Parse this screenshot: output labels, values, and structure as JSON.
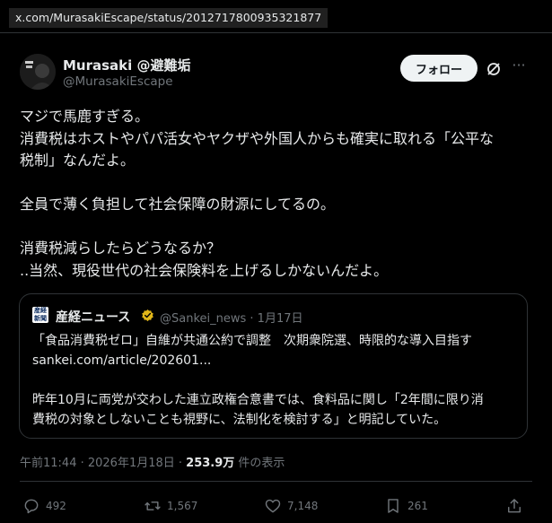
{
  "url_bar": "x.com/MurasakiEscape/status/2012717800935321877",
  "author": {
    "name": "Murasaki @避難垢",
    "handle": "@MurasakiEscape"
  },
  "header": {
    "follow_label": "フォロー",
    "grok_icon": "grok-icon",
    "more_icon": "more-icon"
  },
  "tweet": {
    "lines": [
      "マジで馬鹿すぎる。",
      "消費税はホストやパパ活女やヤクザや外国人からも確実に取れる「公平な",
      "税制」なんだよ。",
      "",
      "全員で薄く負担して社会保障の財源にしてるの。",
      "",
      "消費税減らしたらどうなるか？",
      "..当然、現役世代の社会保険料を上げるしかないんだよ。"
    ]
  },
  "quote": {
    "logo_text": "産経新聞",
    "name": "産経ニュース",
    "handle_date": "@Sankei_news · 1月17日",
    "lines": [
      "「食品消費税ゼロ」自維が共通公約で調整　次期衆院選、時限的な導入目指す",
      "sankei.com/article/202601...",
      "",
      "昨年10月に両党が交わした連立政権合意書では、食料品に関し「2年間に限り消",
      "費税の対象としないことも視野に、法制化を検討する」と明記していた。"
    ]
  },
  "meta": {
    "timestamp": "午前11:44 · 2026年1月18日 · ",
    "views": "253.9万",
    "views_suffix": " 件の表示"
  },
  "actions": {
    "replies": "492",
    "reposts": "1,567",
    "likes": "7,148",
    "bookmarks": "261"
  },
  "colors": {
    "background": "#000000",
    "text": "#e7e9ea",
    "secondary": "#71767b",
    "border": "#2f3336",
    "verified": "#e2b719"
  }
}
